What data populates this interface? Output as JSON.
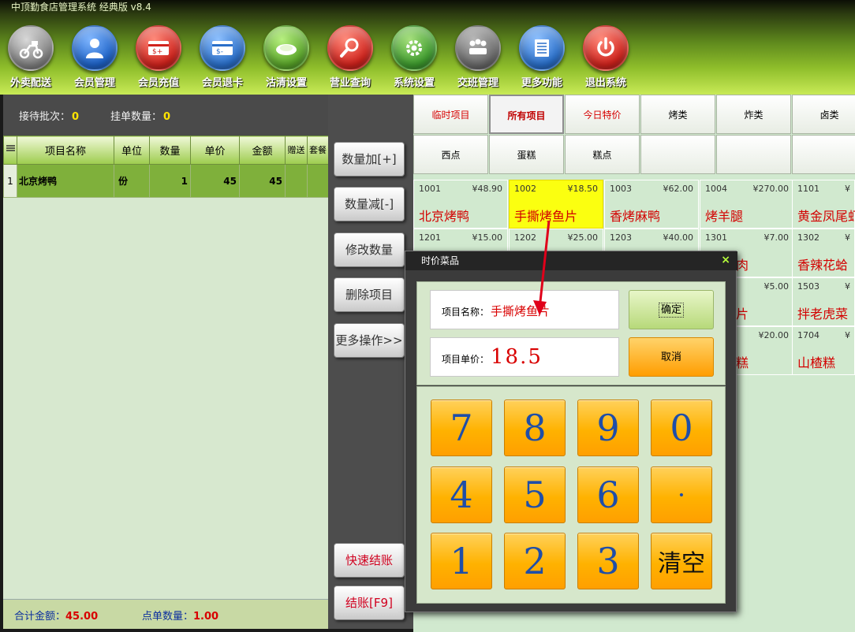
{
  "app": {
    "title": "中顶勤食店管理系统 经典版 v8.4"
  },
  "toolbar": {
    "items": [
      {
        "label": "外卖配送",
        "icon": "scooter-icon",
        "color": "#8a8a8a"
      },
      {
        "label": "会员管理",
        "icon": "user-icon",
        "color": "#1e63c8"
      },
      {
        "label": "会员充值",
        "icon": "card-add-icon",
        "color": "#d0231d"
      },
      {
        "label": "会员退卡",
        "icon": "card-return-icon",
        "color": "#2a6fc9"
      },
      {
        "label": "沽清设置",
        "icon": "plate-icon",
        "color": "#5aa52a"
      },
      {
        "label": "营业查询",
        "icon": "search-icon",
        "color": "#d0231d"
      },
      {
        "label": "系统设置",
        "icon": "gear-icon",
        "color": "#3e9b2e"
      },
      {
        "label": "交班管理",
        "icon": "meeting-icon",
        "color": "#6b6b6b"
      },
      {
        "label": "更多功能",
        "icon": "list-icon",
        "color": "#2a6fc9"
      },
      {
        "label": "退出系统",
        "icon": "power-icon",
        "color": "#d0231d"
      }
    ]
  },
  "stats": {
    "wait_label": "接待批次：",
    "wait_value": "0",
    "hang_label": "挂单数量：",
    "hang_value": "0"
  },
  "order_table": {
    "headers": [
      "项目名称",
      "单位",
      "数量",
      "单价",
      "金额",
      "赠送",
      "套餐"
    ],
    "rows": [
      {
        "index": "1",
        "name": "北京烤鸭",
        "unit": "份",
        "qty": "1",
        "price": "45",
        "amount": "45"
      }
    ]
  },
  "summary": {
    "total_label": "合计金额：",
    "total_value": "45.00",
    "count_label": "点单数量：",
    "count_value": "1.00"
  },
  "actions": {
    "qty_add": "数量加[+]",
    "qty_sub": "数量减[-]",
    "modify_qty": "修改数量",
    "delete_item": "删除项目",
    "more_ops": "更多操作>>",
    "quick_checkout": "快速结账",
    "checkout": "结账[F9]"
  },
  "categories": {
    "row1": [
      "临时项目",
      "所有项目",
      "今日特价",
      "烤类",
      "炸类",
      "卤类"
    ],
    "row2": [
      "西点",
      "蛋糕",
      "糕点",
      "",
      "",
      ""
    ]
  },
  "items": [
    {
      "code": "1001",
      "price": "¥48.90",
      "name": "北京烤鸭"
    },
    {
      "code": "1002",
      "price": "¥18.50",
      "name": "手撕烤鱼片"
    },
    {
      "code": "1003",
      "price": "¥62.00",
      "name": "香烤麻鸭"
    },
    {
      "code": "1004",
      "price": "¥270.00",
      "name": "烤羊腿"
    },
    {
      "code": "1101",
      "price": "¥",
      "name": "黄金凤尾虾"
    },
    {
      "code": "1201",
      "price": "¥15.00",
      "name": ""
    },
    {
      "code": "1202",
      "price": "¥25.00",
      "name": ""
    },
    {
      "code": "1203",
      "price": "¥40.00",
      "name": ""
    },
    {
      "code": "1301",
      "price": "¥7.00",
      "name": "肉"
    },
    {
      "code": "1302",
      "price": "¥",
      "name": "香辣花蛤"
    },
    {
      "code": "",
      "price": "¥5.00",
      "name": "片"
    },
    {
      "code": "1503",
      "price": "¥",
      "name": "拌老虎菜"
    },
    {
      "code": "",
      "price": "¥20.00",
      "name": "糕"
    },
    {
      "code": "1704",
      "price": "¥",
      "name": "山楂糕"
    }
  ],
  "dialog": {
    "title": "时价菜品",
    "close": "×",
    "name_label": "项目名称：",
    "name_value": "手撕烤鱼片",
    "price_label": "项目单价：",
    "price_value": "18.5",
    "ok": "确定",
    "cancel": "取消",
    "keys": [
      "7",
      "8",
      "9",
      "0",
      "4",
      "5",
      "6",
      "·",
      "1",
      "2",
      "3",
      "清空"
    ]
  }
}
